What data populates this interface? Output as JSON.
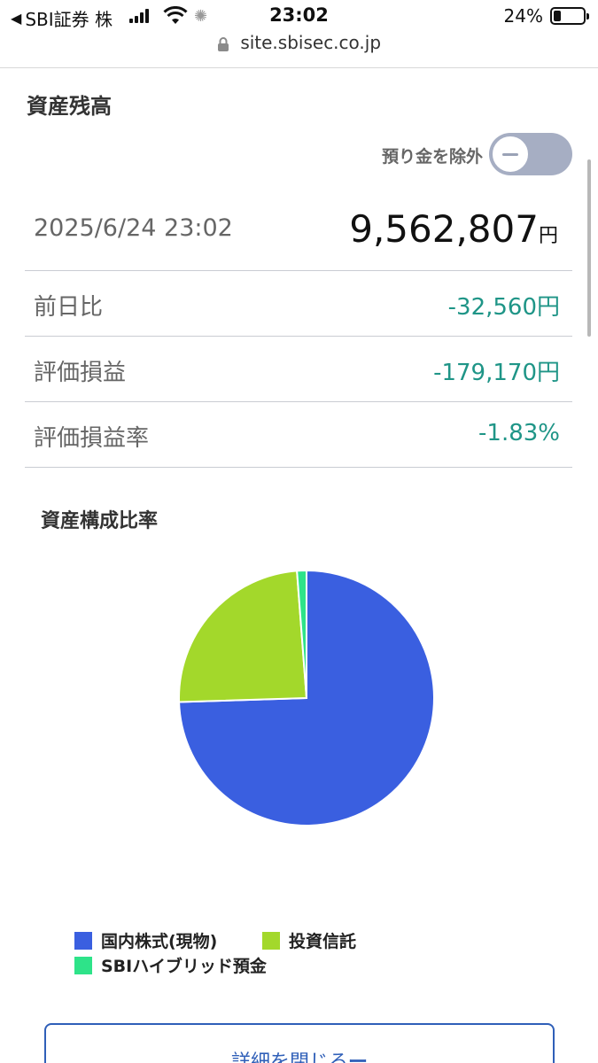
{
  "status_bar": {
    "back_app": "SBI証券 株",
    "time": "23:02",
    "battery": "24%"
  },
  "url_bar": {
    "url": "site.sbisec.co.jp"
  },
  "asset_balance": {
    "title": "資産残高",
    "toggle_label": "預り金を除外",
    "toggle_on": false,
    "date": "2025/6/24 23:02",
    "amount": "9,562,807",
    "amount_unit": "円"
  },
  "stats": [
    {
      "label": "前日比",
      "value": "-32,560円"
    },
    {
      "label": "評価損益",
      "value": "-179,170円"
    },
    {
      "label": "評価損益率",
      "value": "-1.83%"
    }
  ],
  "chart_title": "資産構成比率",
  "chart_data": {
    "type": "pie",
    "title": "資産構成比率",
    "slices": [
      {
        "label": "国内株式(現物)",
        "value": 74.5,
        "color": "#3a5fe0"
      },
      {
        "label": "投資信託",
        "value": 24.3,
        "color": "#a3d82b"
      },
      {
        "label": "SBIハイブリッド預金",
        "value": 1.2,
        "color": "#2ee389"
      }
    ],
    "legend_position": "bottom"
  },
  "close_button": {
    "label": "詳細を閉じる",
    "icon": "minus-icon"
  },
  "colors": {
    "negative": "#1f9587",
    "accent": "#2f5fb8"
  }
}
